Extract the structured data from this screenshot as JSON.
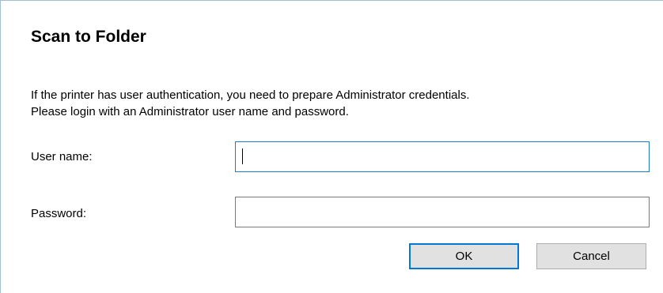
{
  "dialog": {
    "title": "Scan to Folder",
    "description_line1": "If the printer has user authentication, you need to prepare Administrator credentials.",
    "description_line2": "Please login with an Administrator user name and password."
  },
  "form": {
    "username_label": "User name:",
    "username_value": "",
    "password_label": "Password:",
    "password_value": ""
  },
  "buttons": {
    "ok_label": "OK",
    "cancel_label": "Cancel"
  },
  "colors": {
    "focus_border": "#1e7ad2",
    "default_button_border": "#0078d7",
    "button_face": "#e1e1e1"
  }
}
